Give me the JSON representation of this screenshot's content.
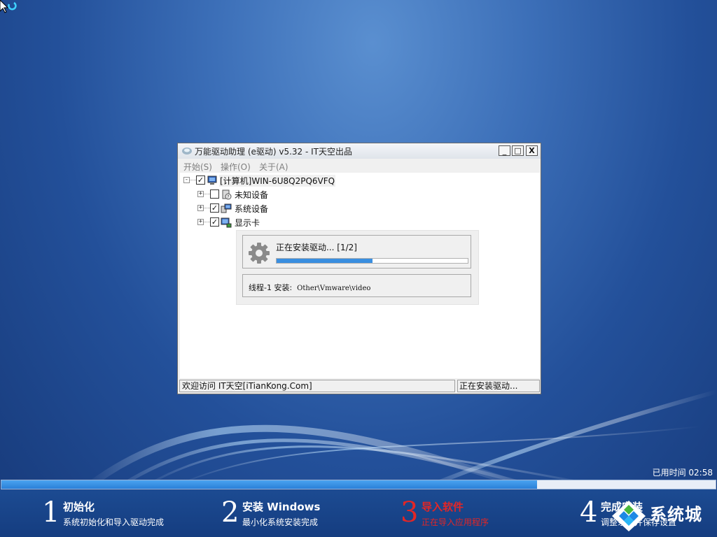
{
  "window": {
    "title": "万能驱动助理 (e驱动) v5.32 - IT天空出品",
    "buttons": {
      "minimize": "_",
      "maximize": "□",
      "close": "X"
    }
  },
  "menu": [
    "开始(S)",
    "操作(O)",
    "关于(A)"
  ],
  "tree": {
    "root": {
      "label": "[计算机]WIN-6U8Q2PQ6VFQ",
      "checked": true,
      "expander": "-"
    },
    "children": [
      {
        "label": "未知设备",
        "checked": false,
        "expander": "+"
      },
      {
        "label": "系统设备",
        "checked": true,
        "expander": "+"
      },
      {
        "label": "显示卡",
        "checked": true,
        "expander": "+"
      }
    ]
  },
  "install_popup": {
    "status": "正在安装驱动... [1/2]",
    "progress": 0.5,
    "thread_label": "线程-1 安装:",
    "thread_path": "Other\\Vmware\\video"
  },
  "statusbar": {
    "left": "欢迎访问 IT天空[iTianKong.Com]",
    "right": "正在安装驱动..."
  },
  "elapsed": "已用时间 02:58",
  "overall_progress": 0.75,
  "steps": [
    {
      "num": "1",
      "title": "初始化",
      "desc": "系统初始化和导入驱动完成",
      "active": false
    },
    {
      "num": "2",
      "title": "安装 Windows",
      "desc": "最小化系统安装完成",
      "active": false
    },
    {
      "num": "3",
      "title": "导入软件",
      "desc": "正在导入应用程序",
      "active": true
    },
    {
      "num": "4",
      "title": "完成安装",
      "desc": "调整系统并保存设置",
      "active": false
    }
  ],
  "watermark": {
    "text": "系统城"
  },
  "colors": {
    "accent": "#3a8fe0",
    "active_step": "#e32626",
    "desktop": "#23509a"
  },
  "icons": {
    "computer": "computer-icon",
    "unknown_device": "unknown-device-icon",
    "system_device": "system-device-icon",
    "display": "display-adapter-icon",
    "gear": "gear-icon"
  }
}
